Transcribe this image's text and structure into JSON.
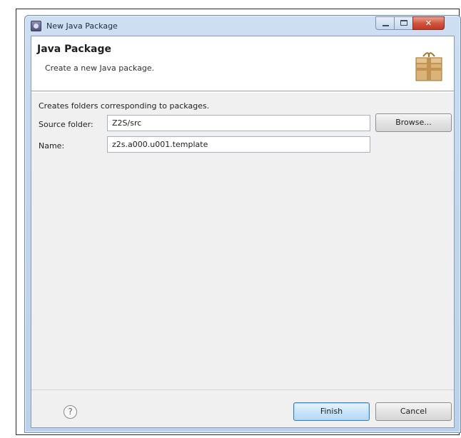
{
  "window": {
    "title": "New Java Package",
    "controls": {
      "minimize": "minimize-icon",
      "maximize": "maximize-icon",
      "close": "close-icon"
    }
  },
  "header": {
    "title": "Java Package",
    "description": "Create a new Java package.",
    "icon": "package-icon"
  },
  "form": {
    "hint": "Creates folders corresponding to packages.",
    "source_folder_label": "Source folder:",
    "source_folder_value": "Z2S/src",
    "browse_label": "Browse...",
    "name_label": "Name:",
    "name_value": "z2s.a000.u001.template"
  },
  "footer": {
    "help_icon": "help-icon",
    "finish_label": "Finish",
    "cancel_label": "Cancel"
  },
  "colors": {
    "title_bar": "#c2d6ee",
    "close_button": "#d2563f",
    "default_button_border": "#3c7fb1"
  }
}
